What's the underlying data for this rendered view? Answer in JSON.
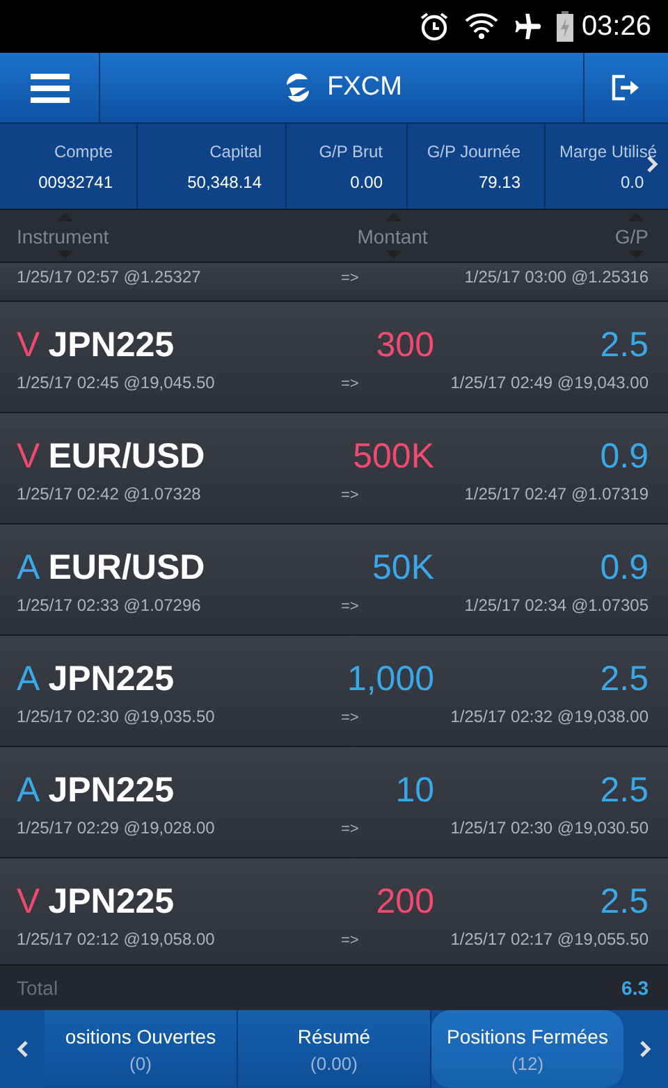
{
  "status_bar": {
    "time": "03:26"
  },
  "header": {
    "title": "FXCM"
  },
  "summary": [
    {
      "label": "Compte",
      "value": "00932741"
    },
    {
      "label": "Capital",
      "value": "50,348.14"
    },
    {
      "label": "G/P Brut",
      "value": "0.00"
    },
    {
      "label": "G/P Journée",
      "value": "79.13"
    },
    {
      "label": "Marge Utilisé",
      "value": "0.0"
    }
  ],
  "columns": [
    "Instrument",
    "Montant",
    "G/P"
  ],
  "cut_row": {
    "open": "1/25/17 02:57 @1.25327",
    "arrow": "=>",
    "close": "1/25/17 03:00 @1.25316"
  },
  "rows": [
    {
      "side": "V",
      "kind": "sell",
      "instrument": "JPN225",
      "amount": "300",
      "pl": "2.5",
      "open": "1/25/17 02:45 @19,045.50",
      "arrow": "=>",
      "close": "1/25/17 02:49 @19,043.00"
    },
    {
      "side": "V",
      "kind": "sell",
      "instrument": "EUR/USD",
      "amount": "500K",
      "pl": "0.9",
      "open": "1/25/17 02:42 @1.07328",
      "arrow": "=>",
      "close": "1/25/17 02:47 @1.07319"
    },
    {
      "side": "A",
      "kind": "buy",
      "instrument": "EUR/USD",
      "amount": "50K",
      "pl": "0.9",
      "open": "1/25/17 02:33 @1.07296",
      "arrow": "=>",
      "close": "1/25/17 02:34 @1.07305"
    },
    {
      "side": "A",
      "kind": "buy",
      "instrument": "JPN225",
      "amount": "1,000",
      "pl": "2.5",
      "open": "1/25/17 02:30 @19,035.50",
      "arrow": "=>",
      "close": "1/25/17 02:32 @19,038.00"
    },
    {
      "side": "A",
      "kind": "buy",
      "instrument": "JPN225",
      "amount": "10",
      "pl": "2.5",
      "open": "1/25/17 02:29 @19,028.00",
      "arrow": "=>",
      "close": "1/25/17 02:30 @19,030.50"
    },
    {
      "side": "V",
      "kind": "sell",
      "instrument": "JPN225",
      "amount": "200",
      "pl": "2.5",
      "open": "1/25/17 02:12 @19,058.00",
      "arrow": "=>",
      "close": "1/25/17 02:17 @19,055.50"
    }
  ],
  "total": {
    "label": "Total",
    "value": "6.3"
  },
  "tabs": [
    {
      "label": "ositions Ouvertes",
      "count": "(0)",
      "selected": false
    },
    {
      "label": "Résumé",
      "count": "(0.00)",
      "selected": false
    },
    {
      "label": "Positions Fermées",
      "count": "(12)",
      "selected": true
    }
  ]
}
